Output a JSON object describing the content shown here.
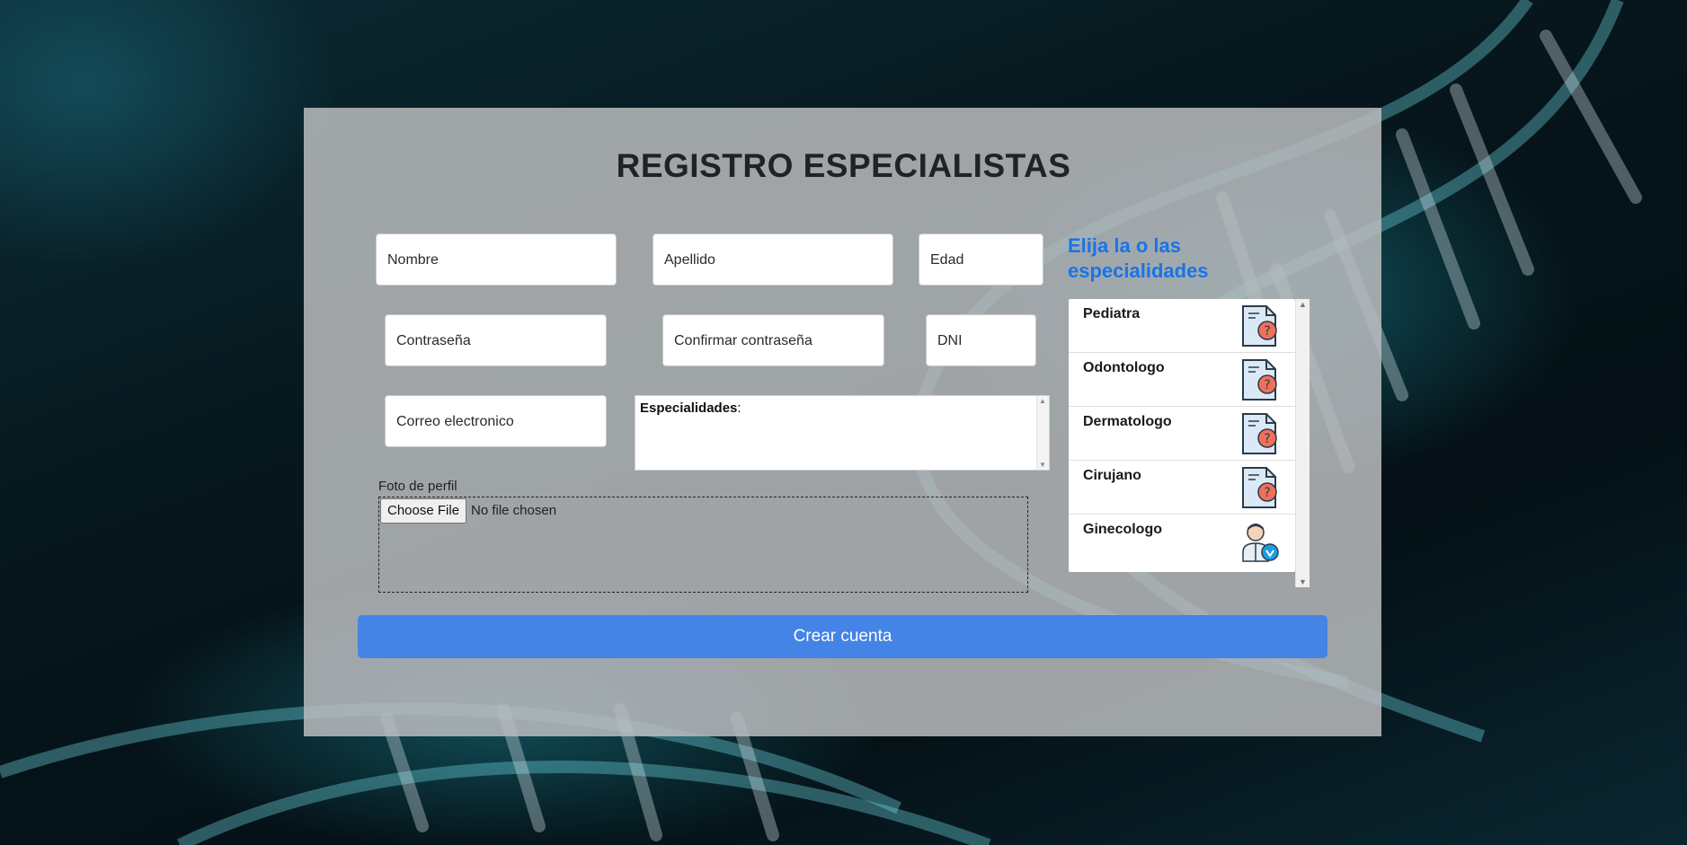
{
  "page": {
    "title": "REGISTRO ESPECIALISTAS"
  },
  "form": {
    "nombre_placeholder": "Nombre",
    "apellido_placeholder": "Apellido",
    "edad_placeholder": "Edad",
    "contrasena_placeholder": "Contraseña",
    "confirmar_placeholder": "Confirmar contraseña",
    "dni_placeholder": "DNI",
    "correo_placeholder": "Correo electronico",
    "especialidades_label": "Especialidades",
    "especialidades_suffix": ":",
    "foto_label": "Foto de perfil",
    "choose_file_label": "Choose File",
    "no_file_text": "No file chosen",
    "submit_label": "Crear cuenta"
  },
  "specialties": {
    "heading": "Elija la o las especialidades",
    "items": [
      {
        "name": "Pediatra",
        "icon": "unknown-document-icon"
      },
      {
        "name": "Odontologo",
        "icon": "unknown-document-icon"
      },
      {
        "name": "Dermatologo",
        "icon": "unknown-document-icon"
      },
      {
        "name": "Cirujano",
        "icon": "unknown-document-icon"
      },
      {
        "name": "Ginecologo",
        "icon": "doctor-icon"
      }
    ]
  },
  "colors": {
    "accent": "#4384e6",
    "heading_blue": "#1a73e8",
    "icon_red": "#f0705a",
    "icon_blue": "#dbe9f6"
  }
}
